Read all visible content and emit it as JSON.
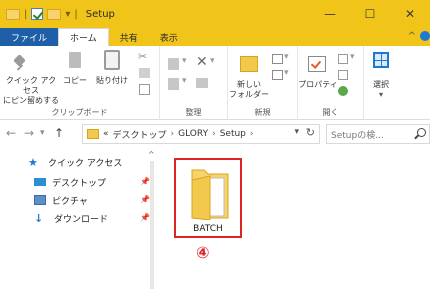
{
  "window": {
    "title": "Setup",
    "title_separator": "|",
    "controls": {
      "minimize": "—",
      "maximize": "☐",
      "close": "✕"
    }
  },
  "tabs": [
    {
      "label": "ファイル",
      "active": false,
      "file": true
    },
    {
      "label": "ホーム",
      "active": true
    },
    {
      "label": "共有",
      "active": false
    },
    {
      "label": "表示",
      "active": false
    }
  ],
  "ribbon": {
    "collapse_glyph": "^",
    "clipboard": {
      "group_label": "クリップボード",
      "pin_label": [
        "クイック アクセス",
        "にピン留めする"
      ],
      "copy_label": "コピー",
      "paste_label": "貼り付け"
    },
    "organize": {
      "group_label": "整理"
    },
    "new": {
      "group_label": "新規",
      "new_folder_label": [
        "新しい",
        "フォルダー"
      ]
    },
    "open": {
      "group_label": "開く",
      "properties_label": "プロパティ"
    },
    "select": {
      "label": "選択"
    }
  },
  "address": {
    "prefix": "«",
    "crumbs": [
      "デスクトップ",
      "GLORY",
      "Setup"
    ],
    "search_placeholder": "Setupの検..."
  },
  "nav": {
    "items": [
      {
        "label": "クイック アクセス",
        "icon": "star-icon"
      },
      {
        "label": "デスクトップ",
        "icon": "desktop-icon",
        "pinned": true
      },
      {
        "label": "ピクチャ",
        "icon": "pictures-icon",
        "pinned": true
      },
      {
        "label": "ダウンロード",
        "icon": "download-icon",
        "pinned": true
      }
    ]
  },
  "content": {
    "items": [
      {
        "name": "BATCH",
        "type": "folder",
        "highlighted": true
      }
    ],
    "marker": "④"
  },
  "colors": {
    "title_bar": "#f0c419",
    "file_tab": "#1f5fa8",
    "highlight": "#e02424",
    "folder": "#f2c94c"
  }
}
